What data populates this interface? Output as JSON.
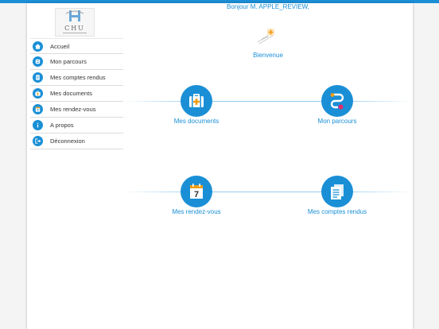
{
  "app": {
    "logo_text": "CHU",
    "accent_color": "#1a8fd6"
  },
  "greeting": "Bonjour M. APPLE_REVIEW,",
  "welcome": {
    "label": "Bienvenue",
    "icon": "welcome-illustration"
  },
  "sidebar": {
    "items": [
      {
        "label": "Accueil",
        "icon": "home-icon"
      },
      {
        "label": "Mon parcours",
        "icon": "route-icon"
      },
      {
        "label": "Mes comptes rendus",
        "icon": "report-icon"
      },
      {
        "label": "Mes documents",
        "icon": "medical-bag-icon"
      },
      {
        "label": "Mes rendez-vous",
        "icon": "calendar-icon"
      },
      {
        "label": "A propos",
        "icon": "info-icon"
      },
      {
        "label": "Déconnexion",
        "icon": "logout-icon"
      }
    ]
  },
  "tiles": [
    {
      "label": "Mes documents",
      "icon": "medical-bag-icon"
    },
    {
      "label": "Mon parcours",
      "icon": "route-icon"
    },
    {
      "label": "Mes rendez-vous",
      "icon": "calendar-icon",
      "day": "7"
    },
    {
      "label": "Mes comptes rendus",
      "icon": "report-icon"
    }
  ]
}
